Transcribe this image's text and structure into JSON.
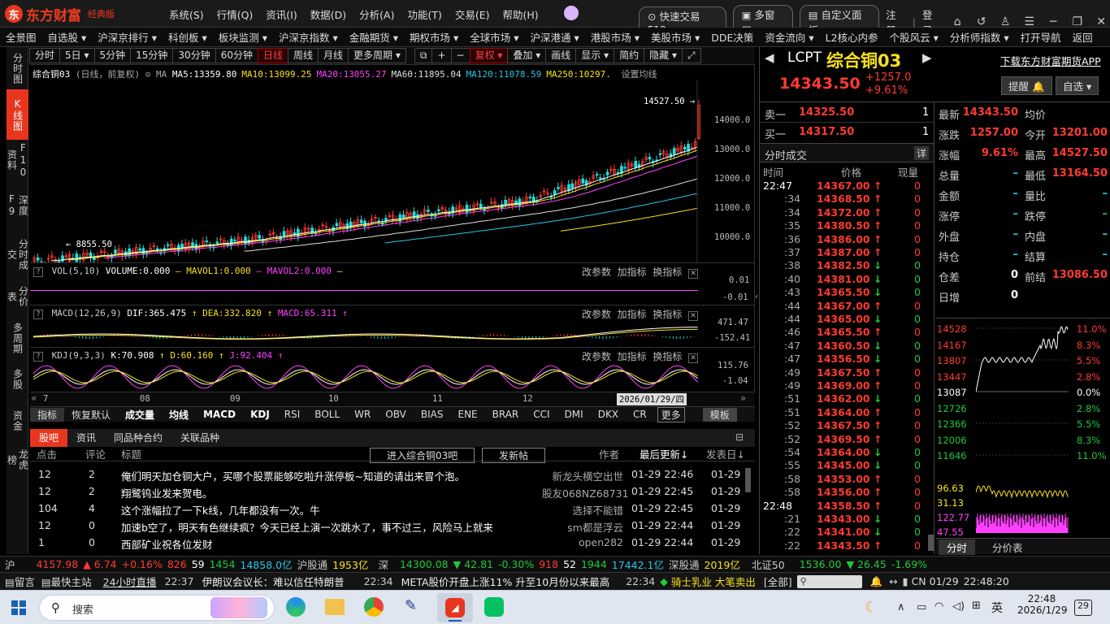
{
  "app": {
    "logo_text": "东方财富",
    "edition": "经典版"
  },
  "menu": [
    "系统(S)",
    "行情(Q)",
    "资讯(I)",
    "数据(D)",
    "分析(A)",
    "功能(T)",
    "交易(E)",
    "帮助(H)"
  ],
  "topright": {
    "quick_trade": "快速交易F12",
    "multi_window": "多窗口",
    "custom_panel": "自定义面板",
    "register": "注册",
    "login": "登录"
  },
  "nav": [
    "全景图",
    "自选股 ▾",
    "沪深京排行 ▾",
    "科创板 ▾",
    "板块监测 ▾",
    "沪深京指数 ▾",
    "金融期货 ▾",
    "期权市场 ▾",
    "全球市场 ▾",
    "沪深港通 ▾",
    "港股市场 ▾",
    "美股市场 ▾",
    "DDE决策",
    "资金流向 ▾",
    "L2核心内参",
    "个股风云 ▾",
    "分析师指数 ▾",
    "打开导航",
    "返回"
  ],
  "vtabs": [
    "分时图",
    "K线图",
    "F10资料",
    "深度F9",
    "分时成交",
    "分价表",
    "多周期",
    "多股",
    "资金",
    "龙虎榜"
  ],
  "chart_toolbar": [
    "分时",
    "5日 ▾",
    "5分钟",
    "15分钟",
    "30分钟",
    "60分钟",
    "日线",
    "周线",
    "月线",
    "更多周期 ▾",
    "⧉",
    "+",
    "−",
    "复权 ▾",
    "叠加 ▾",
    "画线",
    "显示 ▾",
    "简约",
    "隐藏 ▾",
    "⤢"
  ],
  "main_chart": {
    "title": "综合铜03",
    "mode": "(日线，前复权)",
    "ma_label": "MA",
    "ma": [
      {
        "name": "MA5",
        "value": "13359.80",
        "color": "#ffffff"
      },
      {
        "name": "MA10",
        "value": "13099.25",
        "color": "#f7e01c"
      },
      {
        "name": "MA20",
        "value": "13055.27",
        "color": "#ff40ff"
      },
      {
        "name": "MA60",
        "value": "11895.04",
        "color": "#e0e0e0"
      },
      {
        "name": "MA120",
        "value": "11078.59",
        "color": "#27c6e6"
      },
      {
        "name": "MA250",
        "value": "10297.",
        "color": "#f7e01c"
      }
    ],
    "ma_setting": "设置均线",
    "high_label": "14527.50",
    "low_label": "8855.50",
    "yticks": [
      "14000.0",
      "13000.0",
      "12000.0",
      "11000.0",
      "10000.0"
    ],
    "xticks": [
      "7",
      "08",
      "09",
      "10",
      "11",
      "12"
    ],
    "cursor_date": "2026/01/29/四"
  },
  "vol": {
    "head": "VOL(5,10)",
    "volume": "VOLUME:0.000",
    "mavol1": "MAVOL1:0.000",
    "mavol2": "MAVOL2:0.000",
    "ticks": [
      "0.01",
      "-0.01"
    ]
  },
  "macd": {
    "head": "MACD(12,26,9)",
    "dif": "DIF:365.475",
    "dea": "DEA:332.820",
    "macd": "MACD:65.311",
    "ticks": [
      "471.47",
      "-152.41"
    ]
  },
  "kdj": {
    "head": "KDJ(9,3,3)",
    "k": "K:70.908",
    "d": "D:60.160",
    "j": "J:92.404",
    "ticks": [
      "115.76",
      "-1.04"
    ]
  },
  "panel_buttons": {
    "params": "改参数",
    "add": "加指标",
    "swap": "换指标"
  },
  "indicator_tabs": [
    "指标",
    "恢复默认",
    "成交量",
    "均线",
    "MACD",
    "KDJ",
    "RSI",
    "BOLL",
    "WR",
    "OBV",
    "BIAS",
    "ENE",
    "BRAR",
    "CCI",
    "DMI",
    "DKX",
    "CR",
    "更多",
    "模板"
  ],
  "forum": {
    "tabs": [
      "股吧",
      "资讯",
      "同品种合约",
      "关联品种"
    ],
    "header": {
      "clicks": "点击",
      "comments": "评论",
      "title": "标题",
      "enter": "进入综合铜03吧",
      "post": "发新帖",
      "author": "作者",
      "updated": "最后更新↓",
      "posted": "发表日↓"
    },
    "rows": [
      {
        "clicks": "12",
        "comments": "2",
        "title": "俺们明天加仓铜大户，买哪个股票能够吃啦升涨停板~知道的请出来冒个泡。",
        "author": "新龙头横空出世",
        "updated": "01-29 22:46",
        "posted": "01-29"
      },
      {
        "clicks": "12",
        "comments": "2",
        "title": "翔鹭钨业发来贺电。",
        "author": "股友068NZ68731",
        "updated": "01-29 22:45",
        "posted": "01-29"
      },
      {
        "clicks": "104",
        "comments": "4",
        "title": "这个涨幅拉了一下k线，几年都没有一次。牛",
        "author": "选择不能错",
        "updated": "01-29 22:45",
        "posted": "01-29"
      },
      {
        "clicks": "12",
        "comments": "0",
        "title": "加速b空了，明天有色继续疯？今天已经上演一次跳水了，事不过三，风险马上就来",
        "author": "sm都是浮云",
        "updated": "01-29 22:44",
        "posted": "01-29"
      },
      {
        "clicks": "1",
        "comments": "0",
        "title": "西部矿业祝各位发财",
        "author": "open282",
        "updated": "01-29 22:44",
        "posted": "01-29"
      }
    ]
  },
  "quote": {
    "code": "LCPT",
    "name": "综合铜03",
    "price": "14343.50",
    "change": "+1257.0",
    "pct": "+9.61%",
    "download": "下载东方财富期货APP",
    "alert": "提醒",
    "watch": "自选",
    "ask_label": "卖一",
    "ask": "14325.50",
    "ask_vol": "1",
    "bid_label": "买一",
    "bid": "14317.50",
    "bid_vol": "1",
    "stats": [
      [
        "最新",
        "14343.50",
        "均价",
        ""
      ],
      [
        "涨跌",
        "1257.00",
        "今开",
        "13201.00"
      ],
      [
        "涨幅",
        "9.61%",
        "最高",
        "14527.50"
      ],
      [
        "总量",
        "–",
        "最低",
        "13164.50"
      ],
      [
        "金额",
        "–",
        "量比",
        "–"
      ],
      [
        "涨停",
        "–",
        "跌停",
        "–"
      ],
      [
        "外盘",
        "–",
        "内盘",
        "–"
      ],
      [
        "持仓",
        "–",
        "结算",
        "–"
      ],
      [
        "仓差",
        "0",
        "前结",
        "13086.50"
      ],
      [
        "日增",
        "0",
        "",
        ""
      ]
    ]
  },
  "ticks": {
    "title": "分时成交",
    "detail": "详",
    "cols": [
      "时间",
      "价格",
      "现量"
    ],
    "rows": [
      [
        "22:47",
        "14367.00",
        "↑",
        "0"
      ],
      [
        ":34",
        "14368.50",
        "↑",
        "0"
      ],
      [
        ":34",
        "14372.00",
        "↑",
        "0"
      ],
      [
        ":35",
        "14380.50",
        "↑",
        "0"
      ],
      [
        ":36",
        "14386.00",
        "↑",
        "0"
      ],
      [
        ":37",
        "14387.00",
        "↑",
        "0"
      ],
      [
        ":38",
        "14382.50",
        "↓",
        "0"
      ],
      [
        ":40",
        "14381.00",
        "↓",
        "0"
      ],
      [
        ":43",
        "14365.50",
        "↓",
        "0"
      ],
      [
        ":44",
        "14367.00",
        "↑",
        "0"
      ],
      [
        ":44",
        "14365.00",
        "↓",
        "0"
      ],
      [
        ":46",
        "14365.50",
        "↑",
        "0"
      ],
      [
        ":47",
        "14360.50",
        "↓",
        "0"
      ],
      [
        ":47",
        "14356.50",
        "↓",
        "0"
      ],
      [
        ":49",
        "14367.50",
        "↑",
        "0"
      ],
      [
        ":49",
        "14369.00",
        "↑",
        "0"
      ],
      [
        ":51",
        "14362.00",
        "↓",
        "0"
      ],
      [
        ":51",
        "14364.00",
        "↑",
        "0"
      ],
      [
        ":52",
        "14367.50",
        "↑",
        "0"
      ],
      [
        ":52",
        "14369.50",
        "↑",
        "0"
      ],
      [
        ":54",
        "14364.00",
        "↓",
        "0"
      ],
      [
        ":55",
        "14345.00",
        "↓",
        "0"
      ],
      [
        ":58",
        "14353.00",
        "↑",
        "0"
      ],
      [
        ":58",
        "14356.00",
        "↑",
        "0"
      ],
      [
        "22:48",
        "14358.50",
        "↑",
        "0"
      ],
      [
        ":21",
        "14343.00",
        "↓",
        "0"
      ],
      [
        ":22",
        "14341.00",
        "↓",
        "0"
      ],
      [
        ":22",
        "14343.50",
        "↑",
        "0"
      ]
    ]
  },
  "mini": {
    "left": [
      "14528",
      "14167",
      "13807",
      "13447",
      "13087",
      "12726",
      "12366",
      "12006",
      "11646"
    ],
    "right": [
      "11.0%",
      "8.3%",
      "5.5%",
      "2.8%",
      "0.0%",
      "2.8%",
      "5.5%",
      "8.3%",
      "11.0%"
    ],
    "vol_left": [
      "96.63",
      "31.13",
      "122.77",
      "47.55"
    ],
    "tabs": [
      "分时",
      "分价表"
    ]
  },
  "status1": {
    "sh_label": "沪",
    "sh": "4157.98",
    "sh_chg": "▲ 6.74",
    "sh_pct": "+0.16%",
    "sh_up": "826",
    "sh_flat": "59",
    "sh_down": "1454",
    "sh_amt": "14858.0亿",
    "hgt_label": "沪股通",
    "hgt": "1953亿",
    "sz_label": "深",
    "sz": "14300.08",
    "sz_chg": "▼ 42.81",
    "sz_pct": "-0.30%",
    "sz_up": "918",
    "sz_flat": "52",
    "sz_down": "1944",
    "sz_amt": "17442.1亿",
    "sgt_label": "深股通",
    "sgt": "2019亿",
    "bz_label": "北证50",
    "bz": "1536.00",
    "bz_chg": "▼ 26.45",
    "bz_pct": "-1.69%"
  },
  "status2": {
    "msg": "留言",
    "stock_master": "最快主站",
    "live": "24小时直播",
    "t1": "22:37",
    "n1": "伊朗议会议长：难以信任特朗普",
    "t2": "22:34",
    "n2": "META股价开盘上涨11% 升至10月份以来最高",
    "t3": "22:34",
    "n3": "骑士乳业 大笔卖出",
    "all": "[全部]",
    "lang": "CN",
    "date": "01/29",
    "time": "22:48:20"
  },
  "taskbar": {
    "search": "搜索",
    "time": "22:48",
    "date": "2026/1/29",
    "ime": "英"
  }
}
